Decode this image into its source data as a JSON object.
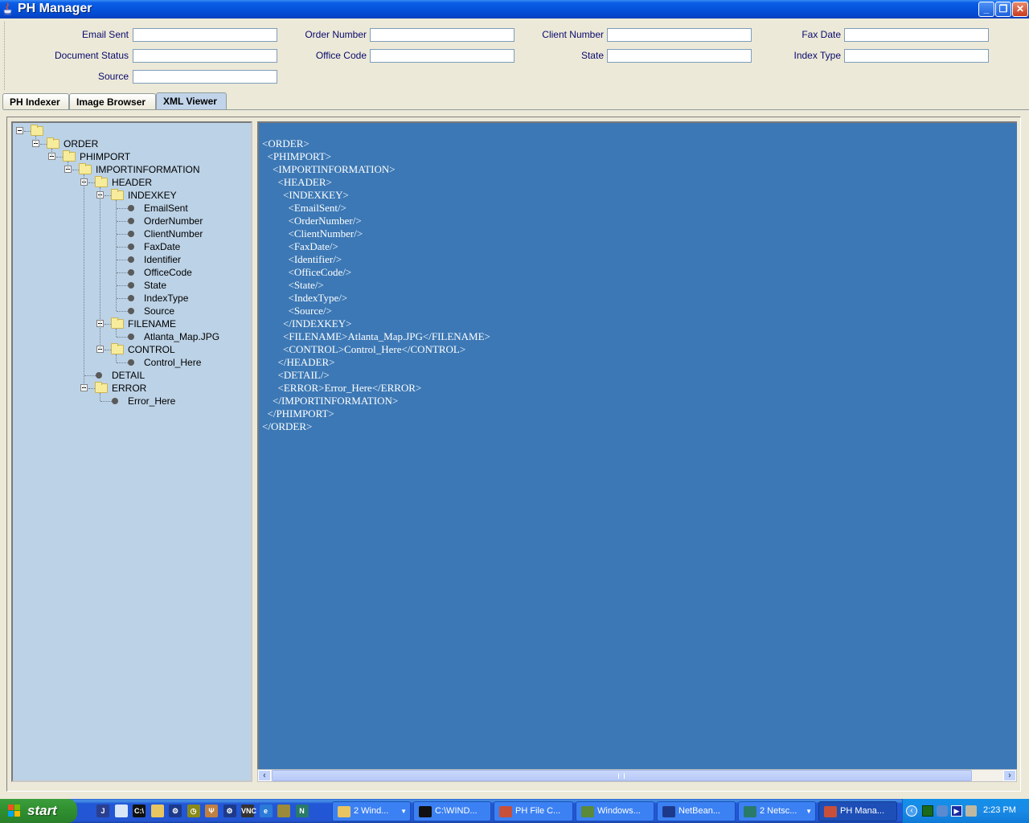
{
  "window": {
    "title": "PH Manager",
    "controls": {
      "minimize": "_",
      "maximize": "❐",
      "close": "✕"
    }
  },
  "form": {
    "fields": [
      {
        "id": "email-sent",
        "label": "Email Sent",
        "value": ""
      },
      {
        "id": "order-number",
        "label": "Order Number",
        "value": ""
      },
      {
        "id": "client-number",
        "label": "Client Number",
        "value": ""
      },
      {
        "id": "fax-date",
        "label": "Fax Date",
        "value": ""
      },
      {
        "id": "document-status",
        "label": "Document Status",
        "value": ""
      },
      {
        "id": "office-code",
        "label": "Office Code",
        "value": ""
      },
      {
        "id": "state",
        "label": "State",
        "value": ""
      },
      {
        "id": "index-type",
        "label": "Index Type",
        "value": ""
      },
      {
        "id": "source",
        "label": "Source",
        "value": ""
      }
    ]
  },
  "tabs": [
    {
      "label": "PH Indexer",
      "active": false
    },
    {
      "label": "Image Browser",
      "active": false
    },
    {
      "label": "XML Viewer",
      "active": true
    }
  ],
  "tree": {
    "nodes": [
      {
        "label": "",
        "type": "folder",
        "depth": 0
      },
      {
        "label": "ORDER",
        "type": "folder",
        "depth": 1
      },
      {
        "label": "PHIMPORT",
        "type": "folder",
        "depth": 2
      },
      {
        "label": "IMPORTINFORMATION",
        "type": "folder",
        "depth": 3
      },
      {
        "label": "HEADER",
        "type": "folder",
        "depth": 4
      },
      {
        "label": "INDEXKEY",
        "type": "folder",
        "depth": 5
      },
      {
        "label": "EmailSent",
        "type": "leaf",
        "depth": 6
      },
      {
        "label": "OrderNumber",
        "type": "leaf",
        "depth": 6
      },
      {
        "label": "ClientNumber",
        "type": "leaf",
        "depth": 6
      },
      {
        "label": "FaxDate",
        "type": "leaf",
        "depth": 6
      },
      {
        "label": "Identifier",
        "type": "leaf",
        "depth": 6
      },
      {
        "label": "OfficeCode",
        "type": "leaf",
        "depth": 6
      },
      {
        "label": "State",
        "type": "leaf",
        "depth": 6
      },
      {
        "label": "IndexType",
        "type": "leaf",
        "depth": 6
      },
      {
        "label": "Source",
        "type": "leaf",
        "depth": 6
      },
      {
        "label": "FILENAME",
        "type": "folder",
        "depth": 5
      },
      {
        "label": "Atlanta_Map.JPG",
        "type": "leaf",
        "depth": 6
      },
      {
        "label": "CONTROL",
        "type": "folder",
        "depth": 5
      },
      {
        "label": "Control_Here",
        "type": "leaf",
        "depth": 6
      },
      {
        "label": "DETAIL",
        "type": "leaf",
        "depth": 4
      },
      {
        "label": "ERROR",
        "type": "folder",
        "depth": 4
      },
      {
        "label": "Error_Here",
        "type": "leaf",
        "depth": 5
      }
    ]
  },
  "xml_viewer": {
    "lines": [
      "<ORDER>",
      " <PHIMPORT>",
      "  <IMPORTINFORMATION>",
      "   <HEADER>",
      "    <INDEXKEY>",
      "     <EmailSent/>",
      "     <OrderNumber/>",
      "     <ClientNumber/>",
      "     <FaxDate/>",
      "     <Identifier/>",
      "     <OfficeCode/>",
      "     <State/>",
      "     <IndexType/>",
      "     <Source/>",
      "    </INDEXKEY>",
      "    <FILENAME>Atlanta_Map.JPG</FILENAME>",
      "    <CONTROL>Control_Here</CONTROL>",
      "   </HEADER>",
      "   <DETAIL/>",
      "   <ERROR>Error_Here</ERROR>",
      "  </IMPORTINFORMATION>",
      " </PHIMPORT>",
      "</ORDER>"
    ],
    "scroll_left": "‹",
    "scroll_right": "›"
  },
  "taskbar": {
    "start_label": "start",
    "quick_launch": [
      {
        "name": "java-icon",
        "glyph": "J",
        "color": "#2a3f8f"
      },
      {
        "name": "notepad-icon",
        "glyph": "",
        "color": "#d8e6f8"
      },
      {
        "name": "cmd-icon",
        "glyph": "C:\\",
        "color": "#111111"
      },
      {
        "name": "folder-icon",
        "glyph": "",
        "color": "#e8c560"
      },
      {
        "name": "netbeans-icon",
        "glyph": "⚙",
        "color": "#1d3a8a"
      },
      {
        "name": "clock-app-icon",
        "glyph": "◷",
        "color": "#8a8a1a"
      },
      {
        "name": "tool-icon",
        "glyph": "Ψ",
        "color": "#c08040"
      },
      {
        "name": "netbeans-icon-2",
        "glyph": "⚙",
        "color": "#1d3a8a"
      },
      {
        "name": "vnc-icon",
        "glyph": "VNC",
        "color": "#333333"
      },
      {
        "name": "internet-explorer-icon",
        "glyph": "e",
        "color": "#2a7ad8"
      },
      {
        "name": "app-icon",
        "glyph": "",
        "color": "#9a8a3a"
      },
      {
        "name": "netscape-icon",
        "glyph": "N",
        "color": "#2a7a6a"
      }
    ],
    "tasks": [
      {
        "label": "2 Wind...",
        "icon": "folder-icon",
        "color": "#e8c560",
        "dropdown": true,
        "active": false
      },
      {
        "label": "C:\\WIND...",
        "icon": "cmd-icon",
        "color": "#111111",
        "dropdown": false,
        "active": false
      },
      {
        "label": "PH File C...",
        "icon": "java-icon",
        "color": "#c8503a",
        "dropdown": false,
        "active": false
      },
      {
        "label": "Windows...",
        "icon": "computer-icon",
        "color": "#5a8a3a",
        "dropdown": false,
        "active": false
      },
      {
        "label": "NetBean...",
        "icon": "netbeans-icon",
        "color": "#1d3a8a",
        "dropdown": false,
        "active": false
      },
      {
        "label": "2 Netsc...",
        "icon": "netscape-icon",
        "color": "#2a7a6a",
        "dropdown": true,
        "active": false
      },
      {
        "label": "PH Mana...",
        "icon": "java-icon",
        "color": "#c8503a",
        "dropdown": false,
        "active": true
      }
    ],
    "tray": {
      "clock": "2:23 PM",
      "icons": [
        "show-hidden-icon",
        "monitor-icon",
        "network-icon",
        "media-icon",
        "server-icon"
      ]
    }
  }
}
